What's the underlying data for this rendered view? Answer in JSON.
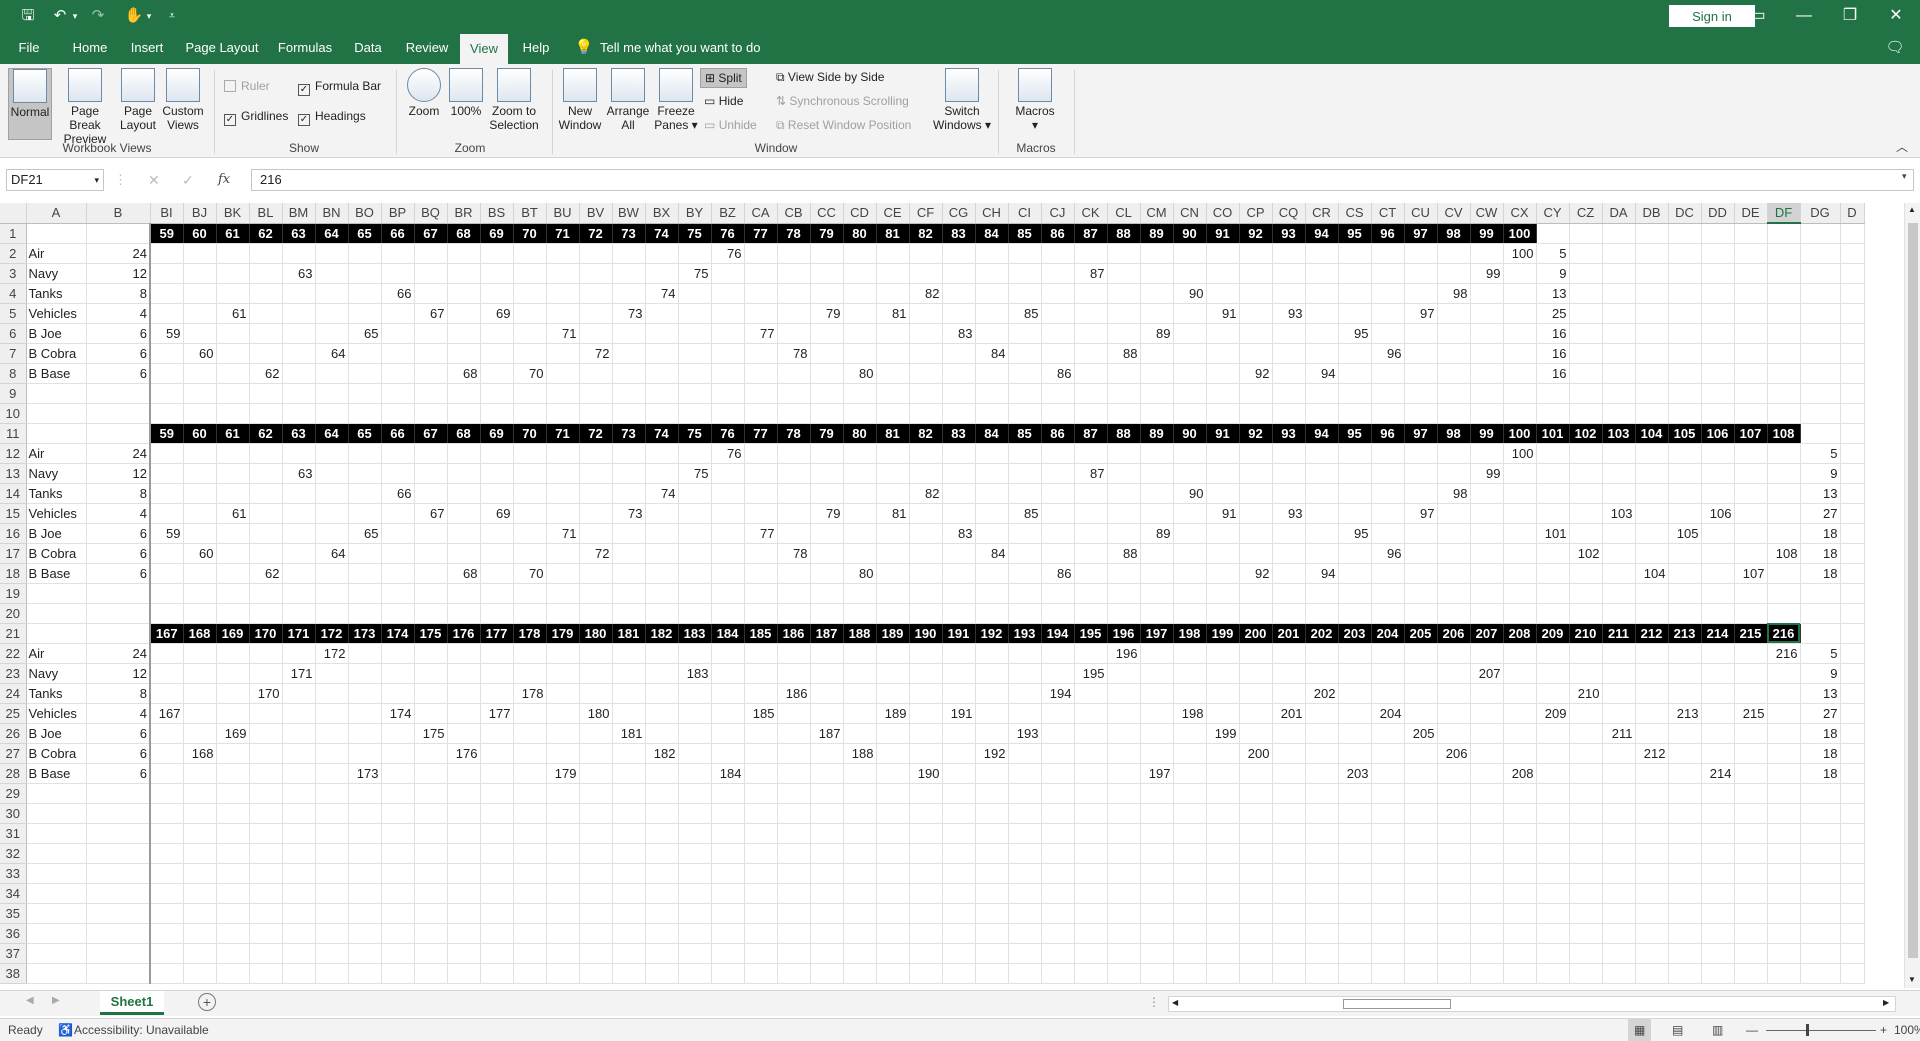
{
  "titlebar": {
    "sign_in": "Sign in"
  },
  "tabs": [
    "File",
    "Home",
    "Insert",
    "Page Layout",
    "Formulas",
    "Data",
    "Review",
    "View",
    "Help"
  ],
  "tell_me": "Tell me what you want to do",
  "ribbon": {
    "views": {
      "normal": "Normal",
      "page_break_1": "Page Break",
      "page_break_2": "Preview",
      "page_layout_1": "Page",
      "page_layout_2": "Layout",
      "custom_1": "Custom",
      "custom_2": "Views",
      "label": "Workbook Views"
    },
    "show": {
      "ruler": "Ruler",
      "formula_bar": "Formula Bar",
      "gridlines": "Gridlines",
      "headings": "Headings",
      "label": "Show"
    },
    "zoom": {
      "zoom": "Zoom",
      "hundred": "100%",
      "zts_1": "Zoom to",
      "zts_2": "Selection",
      "label": "Zoom"
    },
    "window": {
      "new_1": "New",
      "new_2": "Window",
      "arrange_1": "Arrange",
      "arrange_2": "All",
      "freeze_1": "Freeze",
      "freeze_2": "Panes",
      "split": "Split",
      "hide": "Hide",
      "unhide": "Unhide",
      "side": "View Side by Side",
      "sync": "Synchronous Scrolling",
      "reset": "Reset Window Position",
      "switch_1": "Switch",
      "switch_2": "Windows",
      "label": "Window"
    },
    "macros": {
      "macros": "Macros",
      "label": "Macros"
    }
  },
  "formula": {
    "name_box": "DF21",
    "fx": "fx",
    "cancel": "✕",
    "enter": "✓",
    "value": "216"
  },
  "columns": [
    "A",
    "B",
    "BI",
    "BJ",
    "BK",
    "BL",
    "BM",
    "BN",
    "BO",
    "BP",
    "BQ",
    "BR",
    "BS",
    "BT",
    "BU",
    "BV",
    "BW",
    "BX",
    "BY",
    "BZ",
    "CA",
    "CB",
    "CC",
    "CD",
    "CE",
    "CF",
    "CG",
    "CH",
    "CI",
    "CJ",
    "CK",
    "CL",
    "CM",
    "CN",
    "CO",
    "CP",
    "CQ",
    "CR",
    "CS",
    "CT",
    "CU",
    "CV",
    "CW",
    "CX",
    "CY",
    "CZ",
    "DA",
    "DB",
    "DC",
    "DD",
    "DE",
    "DF",
    "DG",
    "D"
  ],
  "rows": [
    {
      "n": "1",
      "hdr": [
        "59",
        "60",
        "61",
        "62",
        "63",
        "64",
        "65",
        "66",
        "67",
        "68",
        "69",
        "70",
        "71",
        "72",
        "73",
        "74",
        "75",
        "76",
        "77",
        "78",
        "79",
        "80",
        "81",
        "82",
        "83",
        "84",
        "85",
        "86",
        "87",
        "88",
        "89",
        "90",
        "91",
        "92",
        "93",
        "94",
        "95",
        "96",
        "97",
        "98",
        "99",
        "100"
      ]
    },
    {
      "n": "2",
      "a": "Air",
      "b": "24",
      "c": {
        "BZ": "76",
        "CX": "100",
        "CY": "5"
      }
    },
    {
      "n": "3",
      "a": "Navy",
      "b": "12",
      "c": {
        "BM": "63",
        "BY": "75",
        "CK": "87",
        "CW": "99",
        "CY": "9"
      }
    },
    {
      "n": "4",
      "a": "Tanks",
      "b": "8",
      "c": {
        "BP": "66",
        "BX": "74",
        "CF": "82",
        "CN": "90",
        "CV": "98",
        "CY": "13"
      }
    },
    {
      "n": "5",
      "a": "Vehicles",
      "b": "4",
      "c": {
        "BK": "61",
        "BQ": "67",
        "BS": "69",
        "BW": "73",
        "CC": "79",
        "CE": "81",
        "CI": "85",
        "CO": "91",
        "CQ": "93",
        "CU": "97",
        "CY": "25"
      }
    },
    {
      "n": "6",
      "a": "B Joe",
      "b": "6",
      "c": {
        "BI": "59",
        "BO": "65",
        "BU": "71",
        "CA": "77",
        "CG": "83",
        "CM": "89",
        "CS": "95",
        "CY": "16"
      }
    },
    {
      "n": "7",
      "a": "B Cobra",
      "b": "6",
      "c": {
        "BJ": "60",
        "BN": "64",
        "BV": "72",
        "CB": "78",
        "CH": "84",
        "CL": "88",
        "CT": "96",
        "CY": "16"
      }
    },
    {
      "n": "8",
      "a": "B Base",
      "b": "6",
      "c": {
        "BL": "62",
        "BR": "68",
        "BT": "70",
        "CD": "80",
        "CJ": "86",
        "CP": "92",
        "CR": "94",
        "CY": "16"
      }
    },
    {
      "n": "9"
    },
    {
      "n": "10"
    },
    {
      "n": "11",
      "hdr": [
        "59",
        "60",
        "61",
        "62",
        "63",
        "64",
        "65",
        "66",
        "67",
        "68",
        "69",
        "70",
        "71",
        "72",
        "73",
        "74",
        "75",
        "76",
        "77",
        "78",
        "79",
        "80",
        "81",
        "82",
        "83",
        "84",
        "85",
        "86",
        "87",
        "88",
        "89",
        "90",
        "91",
        "92",
        "93",
        "94",
        "95",
        "96",
        "97",
        "98",
        "99",
        "100",
        "101",
        "102",
        "103",
        "104",
        "105",
        "106",
        "107",
        "108"
      ]
    },
    {
      "n": "12",
      "a": "Air",
      "b": "24",
      "c": {
        "BZ": "76",
        "CX": "100",
        "DG": "5"
      }
    },
    {
      "n": "13",
      "a": "Navy",
      "b": "12",
      "c": {
        "BM": "63",
        "BY": "75",
        "CK": "87",
        "CW": "99",
        "DG": "9"
      }
    },
    {
      "n": "14",
      "a": "Tanks",
      "b": "8",
      "c": {
        "BP": "66",
        "BX": "74",
        "CF": "82",
        "CN": "90",
        "CV": "98",
        "DG": "13"
      }
    },
    {
      "n": "15",
      "a": "Vehicles",
      "b": "4",
      "c": {
        "BK": "61",
        "BQ": "67",
        "BS": "69",
        "BW": "73",
        "CC": "79",
        "CE": "81",
        "CI": "85",
        "CO": "91",
        "CQ": "93",
        "CU": "97",
        "DA": "103",
        "DD": "106",
        "DG": "27"
      }
    },
    {
      "n": "16",
      "a": "B Joe",
      "b": "6",
      "c": {
        "BI": "59",
        "BO": "65",
        "BU": "71",
        "CA": "77",
        "CG": "83",
        "CM": "89",
        "CS": "95",
        "CY": "101",
        "DC": "105",
        "DG": "18"
      }
    },
    {
      "n": "17",
      "a": "B Cobra",
      "b": "6",
      "c": {
        "BJ": "60",
        "BN": "64",
        "BV": "72",
        "CB": "78",
        "CH": "84",
        "CL": "88",
        "CT": "96",
        "CZ": "102",
        "DF": "108",
        "DG": "18"
      }
    },
    {
      "n": "18",
      "a": "B Base",
      "b": "6",
      "c": {
        "BL": "62",
        "BR": "68",
        "BT": "70",
        "CD": "80",
        "CJ": "86",
        "CP": "92",
        "CR": "94",
        "DB": "104",
        "DE": "107",
        "DG": "18"
      }
    },
    {
      "n": "19"
    },
    {
      "n": "20"
    },
    {
      "n": "21",
      "hdr": [
        "167",
        "168",
        "169",
        "170",
        "171",
        "172",
        "173",
        "174",
        "175",
        "176",
        "177",
        "178",
        "179",
        "180",
        "181",
        "182",
        "183",
        "184",
        "185",
        "186",
        "187",
        "188",
        "189",
        "190",
        "191",
        "192",
        "193",
        "194",
        "195",
        "196",
        "197",
        "198",
        "199",
        "200",
        "201",
        "202",
        "203",
        "204",
        "205",
        "206",
        "207",
        "208",
        "209",
        "210",
        "211",
        "212",
        "213",
        "214",
        "215",
        "216"
      ]
    },
    {
      "n": "22",
      "a": "Air",
      "b": "24",
      "c": {
        "BN": "172",
        "CL": "196",
        "DF": "216",
        "DG": "5"
      }
    },
    {
      "n": "23",
      "a": "Navy",
      "b": "12",
      "c": {
        "BM": "171",
        "BY": "183",
        "CK": "195",
        "CW": "207",
        "DG": "9"
      }
    },
    {
      "n": "24",
      "a": "Tanks",
      "b": "8",
      "c": {
        "BL": "170",
        "BT": "178",
        "CB": "186",
        "CJ": "194",
        "CR": "202",
        "CZ": "210",
        "DG": "13"
      }
    },
    {
      "n": "25",
      "a": "Vehicles",
      "b": "4",
      "c": {
        "BI": "167",
        "BP": "174",
        "BS": "177",
        "BV": "180",
        "CA": "185",
        "CE": "189",
        "CG": "191",
        "CN": "198",
        "CQ": "201",
        "CT": "204",
        "CY": "209",
        "DC": "213",
        "DE": "215",
        "DG": "27"
      }
    },
    {
      "n": "26",
      "a": "B Joe",
      "b": "6",
      "c": {
        "BK": "169",
        "BQ": "175",
        "BW": "181",
        "CC": "187",
        "CI": "193",
        "CO": "199",
        "CU": "205",
        "DA": "211",
        "DG": "18"
      }
    },
    {
      "n": "27",
      "a": "B Cobra",
      "b": "6",
      "c": {
        "BJ": "168",
        "BR": "176",
        "BX": "182",
        "CD": "188",
        "CH": "192",
        "CP": "200",
        "CV": "206",
        "DB": "212",
        "DG": "18"
      }
    },
    {
      "n": "28",
      "a": "B Base",
      "b": "6",
      "c": {
        "BO": "173",
        "BU": "179",
        "BZ": "184",
        "CF": "190",
        "CM": "197",
        "CS": "203",
        "CX": "208",
        "DD": "214",
        "DG": "18"
      }
    },
    {
      "n": "29"
    },
    {
      "n": "30"
    },
    {
      "n": "31"
    },
    {
      "n": "32"
    },
    {
      "n": "33"
    },
    {
      "n": "34"
    },
    {
      "n": "35"
    },
    {
      "n": "36"
    },
    {
      "n": "37"
    },
    {
      "n": "38"
    }
  ],
  "active_cell": {
    "col": "DF",
    "row": "21"
  },
  "sheet_tab": "Sheet1",
  "status": {
    "ready": "Ready",
    "accessibility": "Accessibility: Unavailable",
    "zoom": "100%"
  },
  "colors": {
    "accent": "#217346"
  }
}
